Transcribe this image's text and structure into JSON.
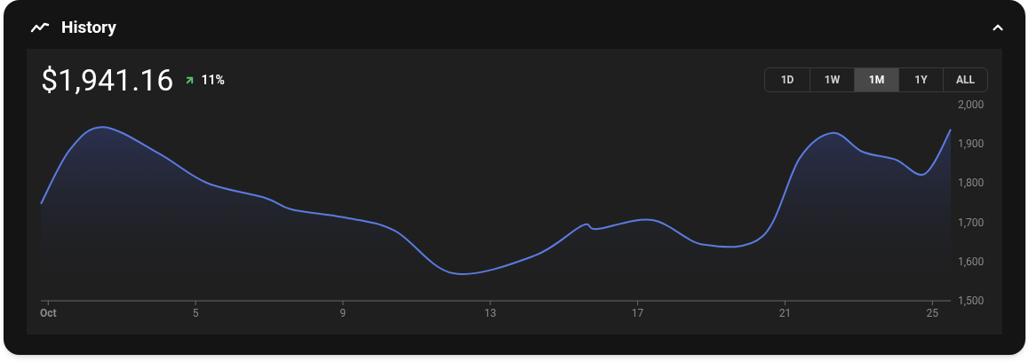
{
  "header": {
    "title": "History",
    "expanded": true
  },
  "price": "$1,941.16",
  "change": {
    "rising": true,
    "text": "11%"
  },
  "ranges": [
    {
      "label": "1D",
      "selected": false
    },
    {
      "label": "1W",
      "selected": false
    },
    {
      "label": "1M",
      "selected": true
    },
    {
      "label": "1Y",
      "selected": false
    },
    {
      "label": "ALL",
      "selected": false
    }
  ],
  "chart_data": {
    "type": "area",
    "x": [
      0.8,
      1.6,
      2.5,
      4,
      5.3,
      6.9,
      7.6,
      9,
      10.4,
      12,
      14.2,
      15.5,
      15.9,
      17.4,
      18.8,
      20.4,
      21.4,
      22.3,
      23.1,
      24,
      24.8,
      25.5
    ],
    "series": [
      {
        "color": "#5b7be0",
        "values": [
          1747,
          1887,
          1943,
          1876,
          1801,
          1762,
          1733,
          1713,
          1679,
          1570,
          1615,
          1692,
          1683,
          1706,
          1643,
          1665,
          1864,
          1928,
          1880,
          1860,
          1824,
          1937
        ]
      }
    ],
    "xlim": [
      0.8,
      25.5
    ],
    "ylim": [
      1500,
      2000
    ],
    "xticks": [
      {
        "value": 1,
        "label": "Oct"
      },
      5,
      9,
      13,
      17,
      21,
      25
    ],
    "yticks": [
      {
        "value": 1500,
        "label": "1,500"
      },
      {
        "value": 1600,
        "label": "1,600"
      },
      {
        "value": 1700,
        "label": "1,700"
      },
      {
        "value": 1800,
        "label": "1,800"
      },
      {
        "value": 1900,
        "label": "1,900"
      },
      {
        "value": 2000,
        "label": "2,000"
      }
    ]
  }
}
